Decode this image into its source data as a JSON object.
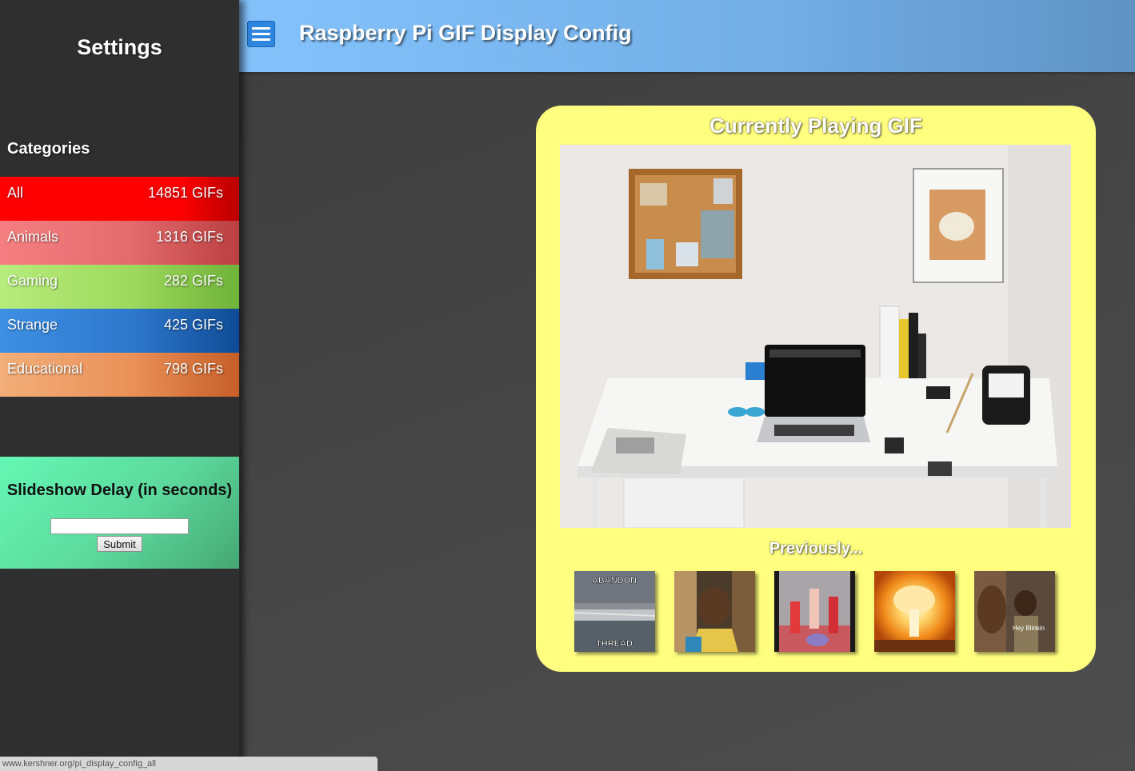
{
  "sidebar": {
    "title": "Settings",
    "categories_heading": "Categories",
    "categories": [
      {
        "name": "All",
        "count": "14851 GIFs",
        "color": "#ff0000"
      },
      {
        "name": "Animals",
        "count": "1316 GIFs",
        "color": "#f57f80"
      },
      {
        "name": "Gaming",
        "count": "282 GIFs",
        "color": "#b6ec7c"
      },
      {
        "name": "Strange",
        "count": "425 GIFs",
        "color": "#3d8fe4"
      },
      {
        "name": "Educational",
        "count": "798 GIFs",
        "color": "#f3ae79"
      }
    ],
    "delay": {
      "heading": "Slideshow Delay (in seconds)",
      "input_value": "",
      "submit_label": "Submit"
    }
  },
  "header": {
    "title": "Raspberry Pi GIF Display Config",
    "menu_icon": "hamburger-menu-icon",
    "accent": "#83c2fc"
  },
  "main": {
    "card_title": "Currently Playing GIF",
    "previous_title": "Previously...",
    "card_color": "#fffe7f",
    "thumbnails": [
      {
        "caption_top": "ABANDON",
        "caption_bottom": "THREAD"
      },
      {
        "caption_top": "",
        "caption_bottom": ""
      },
      {
        "caption_top": "",
        "caption_bottom": ""
      },
      {
        "caption_top": "",
        "caption_bottom": ""
      },
      {
        "caption_top": "",
        "caption_bottom": "Hey Blinkin"
      }
    ]
  },
  "status_bar": {
    "url": "www.kershner.org/pi_display_config_all"
  }
}
